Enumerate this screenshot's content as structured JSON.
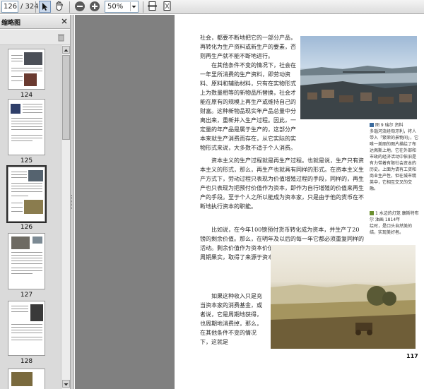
{
  "toolbar": {
    "page_current": "126",
    "page_total": "/ 324",
    "zoom": "50%"
  },
  "sidebar": {
    "title": "缩略图",
    "thumbnails": [
      {
        "label": "124"
      },
      {
        "label": "125"
      },
      {
        "label": "126",
        "current": true
      },
      {
        "label": "127"
      },
      {
        "label": "128"
      }
    ]
  },
  "document": {
    "page_number": "117",
    "paragraphs": [
      "社会，都要不断地把它的一部分产品，再转化为生产资料或新生产的要素，否则再生产就不能不断地进行。",
      "在其他条件不变的情况下，社会在一年里所消费的生产资料，即劳动资料、原料和辅助材料，只有在实物形式上为数量相等的新物品所替换，社会才能在原有的规模上再生产或维持自己的财富。这种新物品现实年产品总量中分离出来，重新并入生产过程。因此，一定量的年产品是属于生产的，这部分产本来就生产消费而存在，从它实际的实物形式来说，大多数不适于个人消费。",
      "资本主义的生产过程就是再生产过程。也就是说，生产只有资本主义的形式，那么，再生产也就具有同样的形式。在资本主义生产方式下，劳动过程只表现为价值增殖过程的手段，同样的，再生产也只表现为把预付价值作为资本，即作为自行增殖的价值来再生产的手段。至于个人之所以能成为资本家，只是由于他的货币在不断地执行资本的职能。",
      "比如说，在今年100镑预付货币转化成为资本，并生产了20镑的剩余价值。那么，在明年及以后的每一年它都必须重复同样的活动。剩余价值作为资本价值的周期增加额或是在过程中的资本的周期果实，取得了来源于资本的收入的形式。",
      "如果这种收入只是充当资本家的消费基金，或者说，它是周期地获得，也周期地消费掉，那么，在其他条件不变的情况下，这就是"
    ],
    "caption1_lines": [
      "图 9 瑞尔  资料",
      "多瑙河流经匈牙利，将人带入「繁荣的景物间」，它唯一美丽的图片描绘了布达佩斯上地，它在外部和市政的经济活动中依旧是有力带着有限社会资本的历史。上面为请有工资和商业生产性，但在城市精英中，它相互交叉的交融。"
    ],
    "caption2_lines": [
      "1 水边的灯笼  康斯特布尔 油画  1814年",
      "绘时，是口头自然美的结，实现美好者。"
    ]
  }
}
